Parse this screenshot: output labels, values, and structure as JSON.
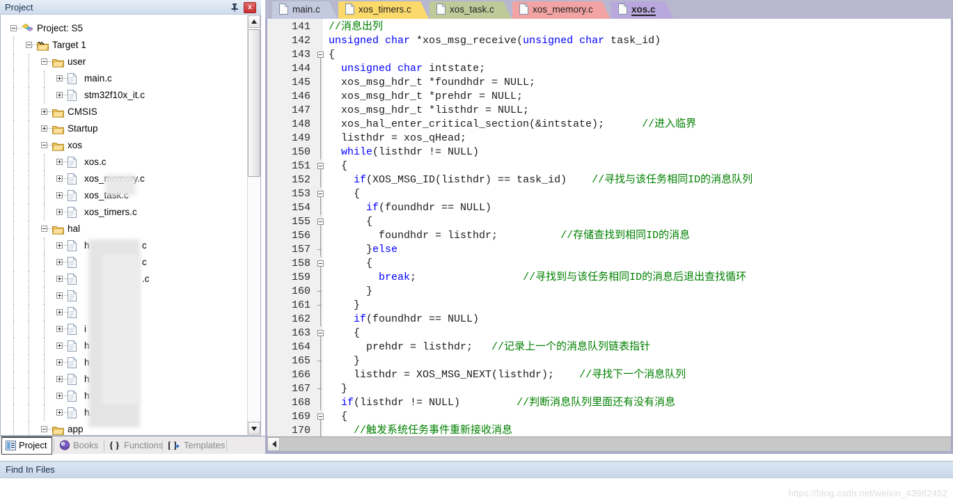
{
  "project_panel": {
    "title": "Project",
    "pin_icon": "pin-icon",
    "close_label": "x",
    "tree": [
      {
        "depth": 0,
        "label": "Project: S5",
        "type": "project",
        "expander": "minus"
      },
      {
        "depth": 1,
        "label": "Target 1",
        "type": "target",
        "expander": "minus"
      },
      {
        "depth": 2,
        "label": "user",
        "type": "folder",
        "expander": "minus"
      },
      {
        "depth": 3,
        "label": "main.c",
        "type": "file",
        "expander": "plus"
      },
      {
        "depth": 3,
        "label": "stm32f10x_it.c",
        "type": "file",
        "expander": "plus"
      },
      {
        "depth": 2,
        "label": "CMSIS",
        "type": "folder",
        "expander": "plus"
      },
      {
        "depth": 2,
        "label": "Startup",
        "type": "folder",
        "expander": "plus"
      },
      {
        "depth": 2,
        "label": "xos",
        "type": "folder",
        "expander": "minus"
      },
      {
        "depth": 3,
        "label": "xos.c",
        "type": "file",
        "expander": "plus"
      },
      {
        "depth": 3,
        "label": "xos_memory.c",
        "type": "file",
        "expander": "plus"
      },
      {
        "depth": 3,
        "label": "xos_task.c",
        "type": "file",
        "expander": "plus"
      },
      {
        "depth": 3,
        "label": "xos_timers.c",
        "type": "file",
        "expander": "plus"
      },
      {
        "depth": 2,
        "label": "hal",
        "type": "folder",
        "expander": "minus"
      },
      {
        "depth": 3,
        "label": "h",
        "type": "file",
        "expander": "plus",
        "blurred": true,
        "tail": "c"
      },
      {
        "depth": 3,
        "label": "",
        "type": "file",
        "expander": "plus",
        "blurred": true,
        "tail": "c"
      },
      {
        "depth": 3,
        "label": "",
        "type": "file",
        "expander": "plus",
        "blurred": true,
        "tail": ".c"
      },
      {
        "depth": 3,
        "label": "",
        "type": "file",
        "expander": "plus",
        "blurred": true,
        "tail": ""
      },
      {
        "depth": 3,
        "label": "",
        "type": "file",
        "expander": "plus",
        "blurred": true,
        "tail": ""
      },
      {
        "depth": 3,
        "label": "i",
        "type": "file",
        "expander": "plus",
        "blurred": true,
        "tail": ""
      },
      {
        "depth": 3,
        "label": "h",
        "type": "file",
        "expander": "plus",
        "blurred": true,
        "tail": ""
      },
      {
        "depth": 3,
        "label": "h",
        "type": "file",
        "expander": "plus",
        "blurred": true,
        "tail": ""
      },
      {
        "depth": 3,
        "label": "h",
        "type": "file",
        "expander": "plus",
        "blurred": true,
        "tail": ""
      },
      {
        "depth": 3,
        "label": "h",
        "type": "file",
        "expander": "plus",
        "blurred": true,
        "tail": ""
      },
      {
        "depth": 3,
        "label": "h.",
        "type": "file",
        "expander": "plus",
        "blurred": true,
        "tail": ""
      },
      {
        "depth": 2,
        "label": "app",
        "type": "folder",
        "expander": "minus"
      }
    ],
    "bottom_tabs": [
      {
        "label": "Project",
        "icon": "project-icon",
        "active": true
      },
      {
        "label": "Books",
        "icon": "books-icon",
        "active": false
      },
      {
        "label": "Functions",
        "icon": "functions-icon",
        "active": false
      },
      {
        "label": "Templates",
        "icon": "templates-icon",
        "active": false
      }
    ]
  },
  "editor": {
    "tabs": [
      {
        "label": "main.c",
        "color": "#c3cadf",
        "active": false
      },
      {
        "label": "xos_timers.c",
        "color": "#fbd96b",
        "active": false
      },
      {
        "label": "xos_task.c",
        "color": "#bfca9a",
        "active": false
      },
      {
        "label": "xos_memory.c",
        "color": "#f2a3a3",
        "active": false
      },
      {
        "label": "xos.c",
        "color": "#b9a8dd",
        "active": true
      }
    ],
    "first_line_number": 141,
    "lines": [
      {
        "n": 141,
        "fold": "none",
        "parts": [
          {
            "t": "//消息出列",
            "c": "cm"
          }
        ],
        "indent": 0
      },
      {
        "n": 142,
        "fold": "none",
        "parts": [
          {
            "t": "unsigned",
            "c": "kw"
          },
          {
            "t": " ",
            "c": "pl"
          },
          {
            "t": "char",
            "c": "kw"
          },
          {
            "t": " *xos_msg_receive(",
            "c": "pl"
          },
          {
            "t": "unsigned",
            "c": "kw"
          },
          {
            "t": " ",
            "c": "pl"
          },
          {
            "t": "char",
            "c": "kw"
          },
          {
            "t": " task_id)",
            "c": "pl"
          }
        ],
        "indent": 0
      },
      {
        "n": 143,
        "fold": "open",
        "parts": [
          {
            "t": "{",
            "c": "pl"
          }
        ],
        "indent": 0
      },
      {
        "n": 144,
        "fold": "bar",
        "parts": [
          {
            "t": "  ",
            "c": "pl"
          },
          {
            "t": "unsigned",
            "c": "kw"
          },
          {
            "t": " ",
            "c": "pl"
          },
          {
            "t": "char",
            "c": "kw"
          },
          {
            "t": " intstate;",
            "c": "pl"
          }
        ],
        "indent": 0
      },
      {
        "n": 145,
        "fold": "bar",
        "parts": [
          {
            "t": "  xos_msg_hdr_t *foundhdr = NULL;",
            "c": "pl"
          }
        ],
        "indent": 0
      },
      {
        "n": 146,
        "fold": "bar",
        "parts": [
          {
            "t": "  xos_msg_hdr_t *prehdr = NULL;",
            "c": "pl"
          }
        ],
        "indent": 0
      },
      {
        "n": 147,
        "fold": "bar",
        "parts": [
          {
            "t": "  xos_msg_hdr_t *listhdr = NULL;",
            "c": "pl"
          }
        ],
        "indent": 0
      },
      {
        "n": 148,
        "fold": "bar",
        "parts": [
          {
            "t": "  xos_hal_enter_critical_section(&intstate);      ",
            "c": "pl"
          },
          {
            "t": "//进入临界",
            "c": "cm"
          }
        ],
        "indent": 0
      },
      {
        "n": 149,
        "fold": "bar",
        "parts": [
          {
            "t": "  listhdr = xos_qHead;",
            "c": "pl"
          }
        ],
        "indent": 0
      },
      {
        "n": 150,
        "fold": "bar",
        "parts": [
          {
            "t": "  ",
            "c": "pl"
          },
          {
            "t": "while",
            "c": "kw"
          },
          {
            "t": "(listhdr != NULL)",
            "c": "pl"
          }
        ],
        "indent": 0
      },
      {
        "n": 151,
        "fold": "open",
        "parts": [
          {
            "t": "  {",
            "c": "pl"
          }
        ],
        "indent": 0
      },
      {
        "n": 152,
        "fold": "bar",
        "parts": [
          {
            "t": "    ",
            "c": "pl"
          },
          {
            "t": "if",
            "c": "kw"
          },
          {
            "t": "(XOS_MSG_ID(listhdr) == task_id)    ",
            "c": "pl"
          },
          {
            "t": "//寻找与该任务相同ID的消息队列",
            "c": "cm"
          }
        ],
        "indent": 0
      },
      {
        "n": 153,
        "fold": "open",
        "parts": [
          {
            "t": "    {",
            "c": "pl"
          }
        ],
        "indent": 0
      },
      {
        "n": 154,
        "fold": "bar",
        "parts": [
          {
            "t": "      ",
            "c": "pl"
          },
          {
            "t": "if",
            "c": "kw"
          },
          {
            "t": "(foundhdr == NULL)",
            "c": "pl"
          }
        ],
        "indent": 0
      },
      {
        "n": 155,
        "fold": "open",
        "parts": [
          {
            "t": "      {",
            "c": "pl"
          }
        ],
        "indent": 0
      },
      {
        "n": 156,
        "fold": "bar",
        "parts": [
          {
            "t": "        foundhdr = listhdr;          ",
            "c": "pl"
          },
          {
            "t": "//存储查找到相同ID的消息",
            "c": "cm"
          }
        ],
        "indent": 0
      },
      {
        "n": 157,
        "fold": "tick",
        "parts": [
          {
            "t": "      }",
            "c": "pl"
          },
          {
            "t": "else",
            "c": "kw"
          }
        ],
        "indent": 0
      },
      {
        "n": 158,
        "fold": "open",
        "parts": [
          {
            "t": "      {",
            "c": "pl"
          }
        ],
        "indent": 0
      },
      {
        "n": 159,
        "fold": "bar",
        "parts": [
          {
            "t": "        ",
            "c": "pl"
          },
          {
            "t": "break",
            "c": "kw"
          },
          {
            "t": ";                 ",
            "c": "pl"
          },
          {
            "t": "//寻找到与该任务相同ID的消息后退出查找循环",
            "c": "cm"
          }
        ],
        "indent": 0
      },
      {
        "n": 160,
        "fold": "tick",
        "parts": [
          {
            "t": "      }",
            "c": "pl"
          }
        ],
        "indent": 0
      },
      {
        "n": 161,
        "fold": "tick",
        "parts": [
          {
            "t": "    }",
            "c": "pl"
          }
        ],
        "indent": 0
      },
      {
        "n": 162,
        "fold": "bar",
        "parts": [
          {
            "t": "    ",
            "c": "pl"
          },
          {
            "t": "if",
            "c": "kw"
          },
          {
            "t": "(foundhdr == NULL)",
            "c": "pl"
          }
        ],
        "indent": 0
      },
      {
        "n": 163,
        "fold": "open",
        "parts": [
          {
            "t": "    {",
            "c": "pl"
          }
        ],
        "indent": 0
      },
      {
        "n": 164,
        "fold": "bar",
        "parts": [
          {
            "t": "      prehdr = listhdr;   ",
            "c": "pl"
          },
          {
            "t": "//记录上一个的消息队列链表指针",
            "c": "cm"
          }
        ],
        "indent": 0
      },
      {
        "n": 165,
        "fold": "tick",
        "parts": [
          {
            "t": "    }",
            "c": "pl"
          }
        ],
        "indent": 0
      },
      {
        "n": 166,
        "fold": "bar",
        "parts": [
          {
            "t": "    listhdr = XOS_MSG_NEXT(listhdr);    ",
            "c": "pl"
          },
          {
            "t": "//寻找下一个消息队列",
            "c": "cm"
          }
        ],
        "indent": 0
      },
      {
        "n": 167,
        "fold": "tick",
        "parts": [
          {
            "t": "  }",
            "c": "pl"
          }
        ],
        "indent": 0
      },
      {
        "n": 168,
        "fold": "bar",
        "parts": [
          {
            "t": "  ",
            "c": "pl"
          },
          {
            "t": "if",
            "c": "kw"
          },
          {
            "t": "(listhdr != NULL)         ",
            "c": "pl"
          },
          {
            "t": "//判断消息队列里面还有没有消息",
            "c": "cm"
          }
        ],
        "indent": 0
      },
      {
        "n": 169,
        "fold": "open",
        "parts": [
          {
            "t": "  {",
            "c": "pl"
          }
        ],
        "indent": 0
      },
      {
        "n": 170,
        "fold": "bar",
        "parts": [
          {
            "t": "    ",
            "c": "pl"
          },
          {
            "t": "//触发系统任务事件重新接收消息",
            "c": "cm"
          }
        ],
        "indent": 0
      }
    ]
  },
  "status": {
    "find_in_files": "Find In Files"
  },
  "watermark": "https://blog.csdn.net/weixin_43982452",
  "colors": {
    "keyword": "#0000ff",
    "comment": "#008000",
    "plain": "#1b1b1b",
    "editor_chrome": "#b7b7d0",
    "panel_title": "#dbe5f1"
  }
}
